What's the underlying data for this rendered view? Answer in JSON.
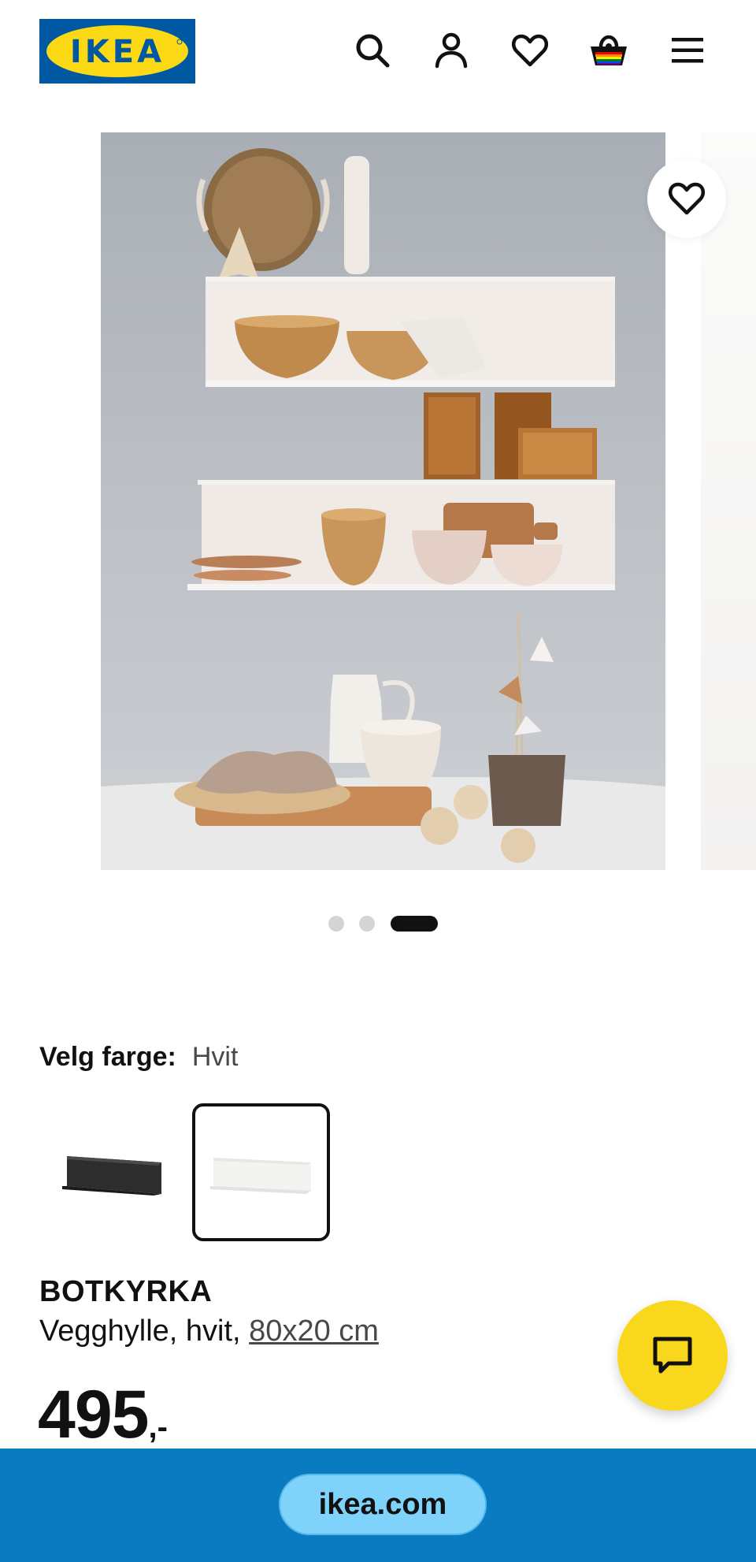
{
  "header": {
    "logo_text": "IKEA",
    "icons": [
      "search-icon",
      "account-icon",
      "heart-icon",
      "basket-icon",
      "menu-icon"
    ]
  },
  "gallery": {
    "image_count": 3,
    "active_index": 3,
    "favorite_icon": "heart-icon"
  },
  "color_chooser": {
    "label": "Velg farge:",
    "selected_value": "Hvit",
    "options": [
      {
        "name": "black",
        "selected": false
      },
      {
        "name": "white",
        "selected": true
      }
    ]
  },
  "product": {
    "name": "BOTKYRKA",
    "description": "Vegghylle, hvit, ",
    "size": "80x20 cm",
    "price": "495",
    "price_suffix": ",-"
  },
  "chat": {
    "icon": "chat-icon"
  },
  "browser": {
    "url": "ikea.com"
  },
  "colors": {
    "ikea_blue": "#0058a3",
    "ikea_yellow": "#fbd914",
    "bottom_bar": "#0a7bc0",
    "url_pill": "#7fd3fb"
  }
}
